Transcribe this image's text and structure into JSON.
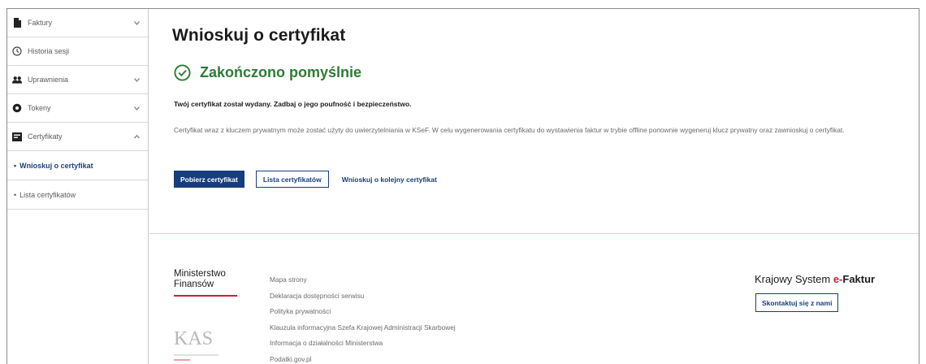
{
  "sidebar": {
    "items": [
      {
        "label": "Faktury",
        "icon": "document-icon"
      },
      {
        "label": "Historia sesji",
        "icon": "clock-icon"
      },
      {
        "label": "Uprawnienia",
        "icon": "users-icon"
      },
      {
        "label": "Tokeny",
        "icon": "token-icon"
      },
      {
        "label": "Certyfikaty",
        "icon": "certificate-icon"
      }
    ],
    "sub_items": [
      {
        "label": "Wnioskuj o certyfikat",
        "active": true
      },
      {
        "label": "Lista certyfikatów",
        "active": false
      }
    ]
  },
  "main": {
    "title": "Wnioskuj o certyfikat",
    "status": "Zakończono pomyślnie",
    "info_bold": "Twój certyfikat został wydany. Zadbaj o jego poufność i bezpieczeństwo.",
    "info_text": "Certyfikat wraz z kluczem prywatnym może zostać użyty do uwierzytelniania w KSeF. W celu wygenerowania certyfikatu do wystawienia faktur w trybie offline ponownie wygeneruj klucz prywatny oraz zawnioskuj o certyfikat.",
    "buttons": {
      "download": "Pobierz certyfikat",
      "list": "Lista certyfikatów",
      "next": "Wnioskuj o kolejny certyfikat"
    }
  },
  "footer": {
    "mf_line1": "Ministerstwo",
    "mf_line2": "Finansów",
    "kas_logo_text": "KAS",
    "links": [
      "Mapa strony",
      "Deklaracja dostępności serwisu",
      "Polityka prywatności",
      "Klauzula informacyjna Szefa Krajowej Administracji Skarbowej",
      "Informacja o działalności Ministerstwa",
      "Podatki.gov.pl"
    ],
    "ksef_prefix": "Krajowy System ",
    "ksef_e": "e-",
    "ksef_faktur": "Faktur",
    "contact": "Skontaktuj się z nami"
  },
  "colors": {
    "primary": "#163e7e",
    "success": "#2d7d32",
    "accent_red": "#d11f3a"
  }
}
